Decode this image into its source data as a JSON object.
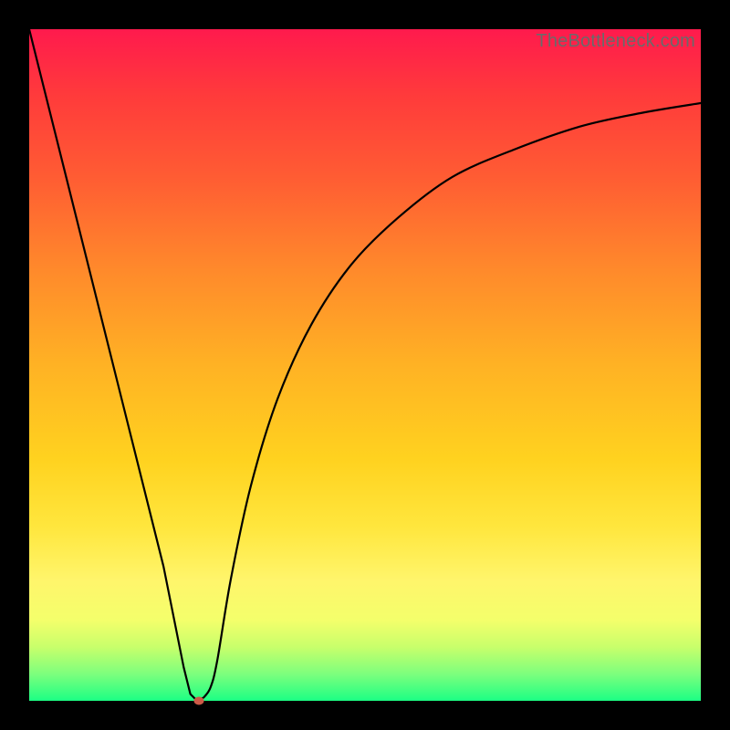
{
  "watermark": "TheBottleneck.com",
  "colors": {
    "frame": "#000000",
    "curve_stroke": "#000000",
    "marker": "#cc5a47",
    "gradient_top": "#ff1a4d",
    "gradient_bottom": "#1cff84"
  },
  "chart_data": {
    "type": "line",
    "title": "",
    "xlabel": "",
    "ylabel": "",
    "xlim": [
      0,
      100
    ],
    "ylim": [
      0,
      100
    ],
    "grid": false,
    "legend": false,
    "series": [
      {
        "name": "curve",
        "x": [
          0,
          5,
          10,
          15,
          20,
          23,
          24,
          25,
          26,
          27,
          28,
          30,
          33,
          37,
          42,
          48,
          55,
          63,
          72,
          82,
          91,
          100
        ],
        "values": [
          100,
          80,
          60,
          40,
          20,
          5,
          1,
          0,
          0.5,
          2,
          6,
          18,
          32,
          45,
          56,
          65,
          72,
          78,
          82,
          85.5,
          87.5,
          89
        ]
      }
    ],
    "marker": {
      "x": 25.3,
      "y": 0.0
    },
    "notes": "Values estimated from pixel positions against gradient; y=0 is bottom (green), y=100 is top (red)."
  }
}
